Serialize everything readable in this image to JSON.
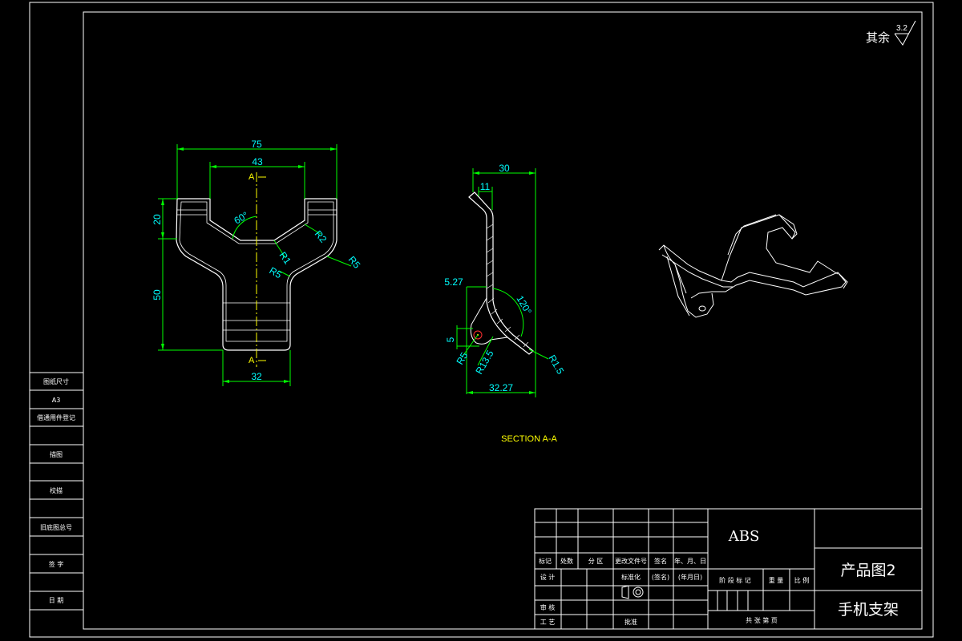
{
  "colors": {
    "background": "#000000",
    "frame": "#ffffff",
    "dimension": "#00ff00",
    "dim_text": "#00ffff",
    "centerline": "#ffff00",
    "section": "#ffff00"
  },
  "roughness": {
    "label": "其余",
    "value": "3.2"
  },
  "front_view": {
    "dims": {
      "overall_width": "75",
      "inner_width": "43",
      "base_width": "32",
      "height_top": "20",
      "height_body": "50"
    },
    "annotations": {
      "angle": "60°",
      "r2": "R2",
      "r1": "R1",
      "r5_left": "R5",
      "r5_right": "R5"
    },
    "section_mark": "A"
  },
  "section_view": {
    "dims": {
      "width_top": "30",
      "flange": "11",
      "offset": "5.27",
      "hole_offset": "5",
      "width_bottom": "32.27"
    },
    "annotations": {
      "angle": "120°",
      "r5": "R5",
      "r13_5": "R13.5",
      "r1_5": "R1.5"
    },
    "caption": "SECTION A-A"
  },
  "left_strip": {
    "items": [
      "图纸尺寸",
      "A3",
      "借通用件登记",
      "",
      "描图",
      "",
      "校描",
      "",
      "旧底图总号",
      "",
      "签  字",
      "",
      "日  期",
      ""
    ]
  },
  "title_block": {
    "material": "ABS",
    "drawing_name": "产品图2",
    "part_name": "手机支架",
    "rev_headers": [
      "标记",
      "处数",
      "分 区",
      "更改文件号",
      "签名",
      "年、月、日"
    ],
    "row_design": "设  计",
    "row_std": "标准化",
    "row_sign": "(签名)",
    "row_date": "(年月日)",
    "stage_headers": [
      "阶 段 标 记",
      "重 量",
      "比 例"
    ],
    "row_review": "审  核",
    "row_process": "工  艺",
    "row_approve": "批准",
    "sheet_text": "共    张    第    页"
  }
}
